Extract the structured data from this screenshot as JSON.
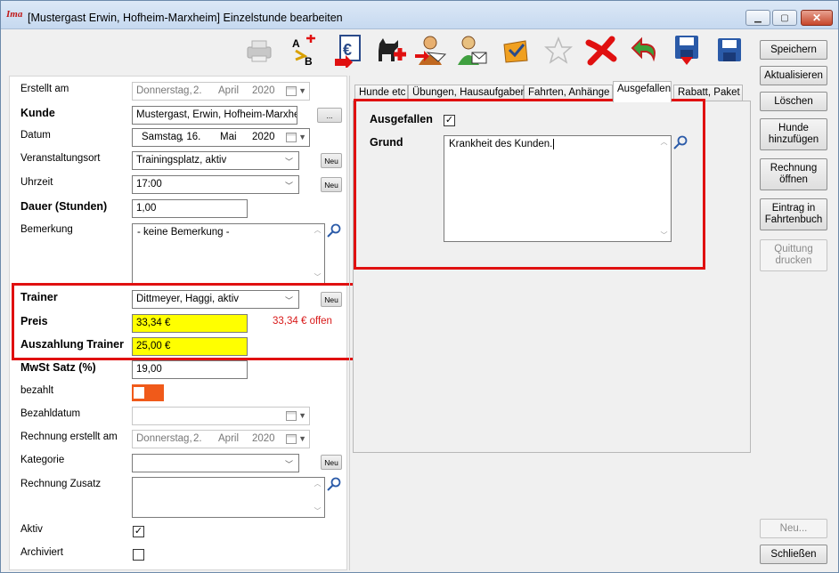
{
  "window": {
    "app_icon_text": "Ima",
    "title": "[Mustergast Erwin, Hofheim-Marxheim] Einzelstunde bearbeiten"
  },
  "toolbar_icons": [
    "printer-icon",
    "sort-ab-icon",
    "invoice-euro-icon",
    "add-dog-icon",
    "send-person-icon",
    "person-mail-icon",
    "mail-check-icon",
    "star-outline-icon",
    "delete-x-icon",
    "undo-arrow-icon",
    "save-down-icon",
    "save-icon"
  ],
  "form": {
    "erstellt_am": {
      "label": "Erstellt am",
      "weekday": "Donnerstag,",
      "day": "2.",
      "month": "April",
      "year": "2020"
    },
    "kunde": {
      "label": "Kunde",
      "value": "Mustergast, Erwin, Hofheim-Marxheim",
      "button": "..."
    },
    "datum": {
      "label": "Datum",
      "weekday": "Samstag",
      "day": ", 16.",
      "month": "Mai",
      "year": "2020"
    },
    "veranstaltungsort": {
      "label": "Veranstaltungsort",
      "value": "Trainingsplatz, aktiv",
      "button": "Neu"
    },
    "uhrzeit": {
      "label": "Uhrzeit",
      "value": "17:00",
      "button": "Neu"
    },
    "dauer": {
      "label": "Dauer (Stunden)",
      "value": "1,00"
    },
    "bemerkung": {
      "label": "Bemerkung",
      "value": "- keine Bemerkung -"
    },
    "trainer": {
      "label": "Trainer",
      "value": "Dittmeyer, Haggi, aktiv",
      "button": "Neu"
    },
    "preis": {
      "label": "Preis",
      "value": "33,34 €",
      "offen": "33,34 € offen"
    },
    "auszahlung": {
      "label": "Auszahlung Trainer",
      "value": "25,00 €"
    },
    "mwst": {
      "label": "MwSt Satz (%)",
      "value": "19,00"
    },
    "bezahlt": {
      "label": "bezahlt"
    },
    "bezahldatum": {
      "label": "Bezahldatum"
    },
    "rechnung_erstellt": {
      "label": "Rechnung erstellt am",
      "weekday": "Donnerstag,",
      "day": "2.",
      "month": "April",
      "year": "2020"
    },
    "kategorie": {
      "label": "Kategorie",
      "button": "Neu"
    },
    "rechnung_zusatz": {
      "label": "Rechnung Zusatz"
    },
    "aktiv": {
      "label": "Aktiv",
      "checked": "✓"
    },
    "archiviert": {
      "label": "Archiviert"
    }
  },
  "tabs": [
    "Hunde etc",
    "Übungen, Hausaufgaben",
    "Fahrten, Anhänge",
    "Ausgefallen",
    "Rabatt, Paket"
  ],
  "ausgefallen": {
    "label": "Ausgefallen",
    "checked": "✓",
    "grund_label": "Grund",
    "grund_value": "Krankheit des Kunden."
  },
  "side_buttons": {
    "speichern": "Speichern",
    "aktualisieren": "Aktualisieren",
    "loeschen": "Löschen",
    "hunde_1": "Hunde",
    "hunde_2": "hinzufügen",
    "rechnung_1": "Rechnung",
    "rechnung_2": "öffnen",
    "eintrag_1": "Eintrag in",
    "eintrag_2": "Fahrtenbuch",
    "quittung_1": "Quittung",
    "quittung_2": "drucken",
    "neu": "Neu...",
    "schliessen": "Schließen"
  },
  "colors": {
    "highlight": "#ffff00",
    "toggle": "#f05a1a",
    "annotation": "#e01010",
    "offen": "#d81818"
  }
}
